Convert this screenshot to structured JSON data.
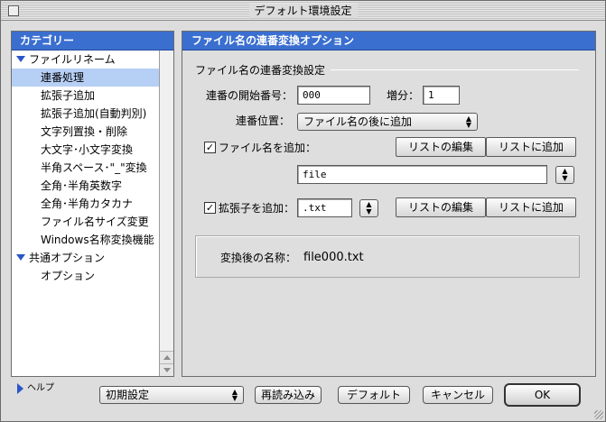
{
  "window": {
    "title": "デフォルト環境設定"
  },
  "sidebar": {
    "header": "カテゴリー",
    "items": [
      {
        "label": "ファイルリネーム",
        "level": "parent"
      },
      {
        "label": "連番処理",
        "level": "child",
        "selected": true
      },
      {
        "label": "拡張子追加",
        "level": "child"
      },
      {
        "label": "拡張子追加(自動判別)",
        "level": "child"
      },
      {
        "label": "文字列置換・削除",
        "level": "child"
      },
      {
        "label": "大文字･小文字変換",
        "level": "child"
      },
      {
        "label": "半角スペース･\"_\"変換",
        "level": "child"
      },
      {
        "label": "全角･半角英数字",
        "level": "child"
      },
      {
        "label": "全角･半角カタカナ",
        "level": "child"
      },
      {
        "label": "ファイル名サイズ変更",
        "level": "child"
      },
      {
        "label": "Windows名称変換機能",
        "level": "child"
      },
      {
        "label": "共通オプション",
        "level": "parent"
      },
      {
        "label": "オプション",
        "level": "child"
      }
    ]
  },
  "main": {
    "header": "ファイル名の連番変換オプション",
    "group_title": "ファイル名の連番変換設定",
    "start_label": "連番の開始番号：",
    "start_value": "000",
    "increment_label": "増分：",
    "increment_value": "1",
    "position_label": "連番位置：",
    "position_value": "ファイル名の後に追加",
    "add_name_label": "ファイル名を追加：",
    "add_name_checked": true,
    "edit_list_label": "リストの編集",
    "add_to_list_label": "リストに追加",
    "filename_value": "file",
    "add_ext_label": "拡張子を追加：",
    "add_ext_checked": true,
    "ext_value": ".txt",
    "edit_list_label2": "リストの編集",
    "add_to_list_label2": "リストに追加",
    "result_label": "変換後の名称：",
    "result_value": "file000.txt"
  },
  "footer": {
    "help_label": "ヘルプ",
    "preset_value": "初期設定",
    "reload_label": "再読み込み",
    "default_label": "デフォルト",
    "cancel_label": "キャンセル",
    "ok_label": "OK"
  },
  "colors": {
    "accent": "#3a6fd0",
    "selection": "#b6cff5"
  },
  "icons": {
    "check": "✓",
    "spinner": "▲▼",
    "expanded": "triangle-down-icon",
    "help": "triangle-right-icon"
  }
}
